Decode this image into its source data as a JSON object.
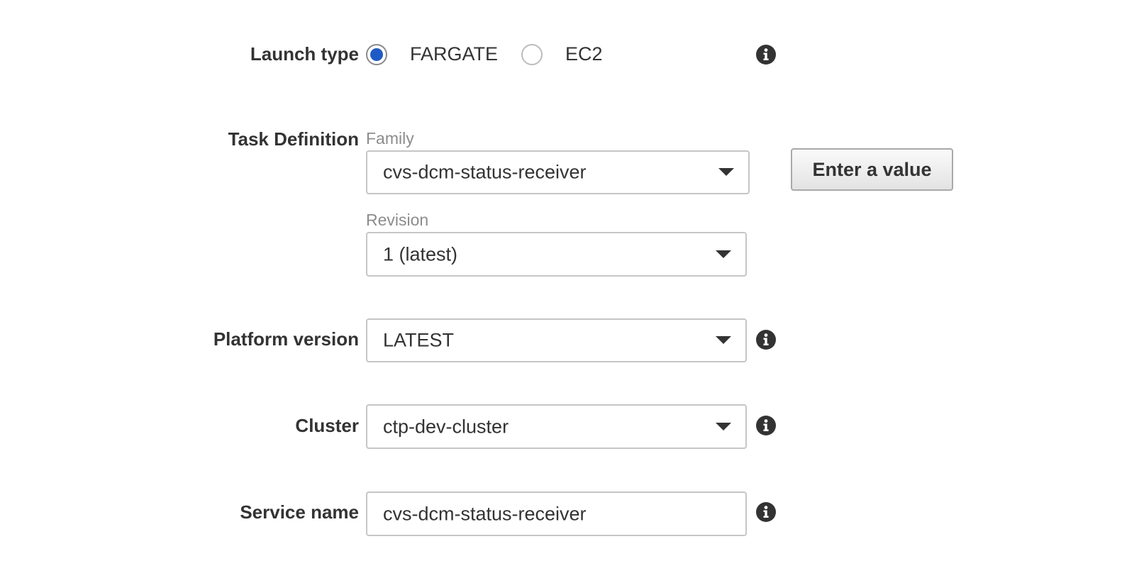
{
  "launch_type": {
    "label": "Launch type",
    "options": [
      {
        "label": "FARGATE",
        "selected": true
      },
      {
        "label": "EC2",
        "selected": false
      }
    ],
    "accent_color": "#1f5bc4",
    "info_icon": "info-icon"
  },
  "task_definition": {
    "label": "Task Definition",
    "family": {
      "label": "Family",
      "value": "cvs-dcm-status-receiver"
    },
    "revision": {
      "label": "Revision",
      "value": "1 (latest)"
    },
    "enter_value_button": "Enter a value"
  },
  "platform_version": {
    "label": "Platform version",
    "value": "LATEST",
    "info_icon": "info-icon"
  },
  "cluster": {
    "label": "Cluster",
    "value": "ctp-dev-cluster",
    "info_icon": "info-icon"
  },
  "service_name": {
    "label": "Service name",
    "value": "cvs-dcm-status-receiver",
    "info_icon": "info-icon"
  }
}
